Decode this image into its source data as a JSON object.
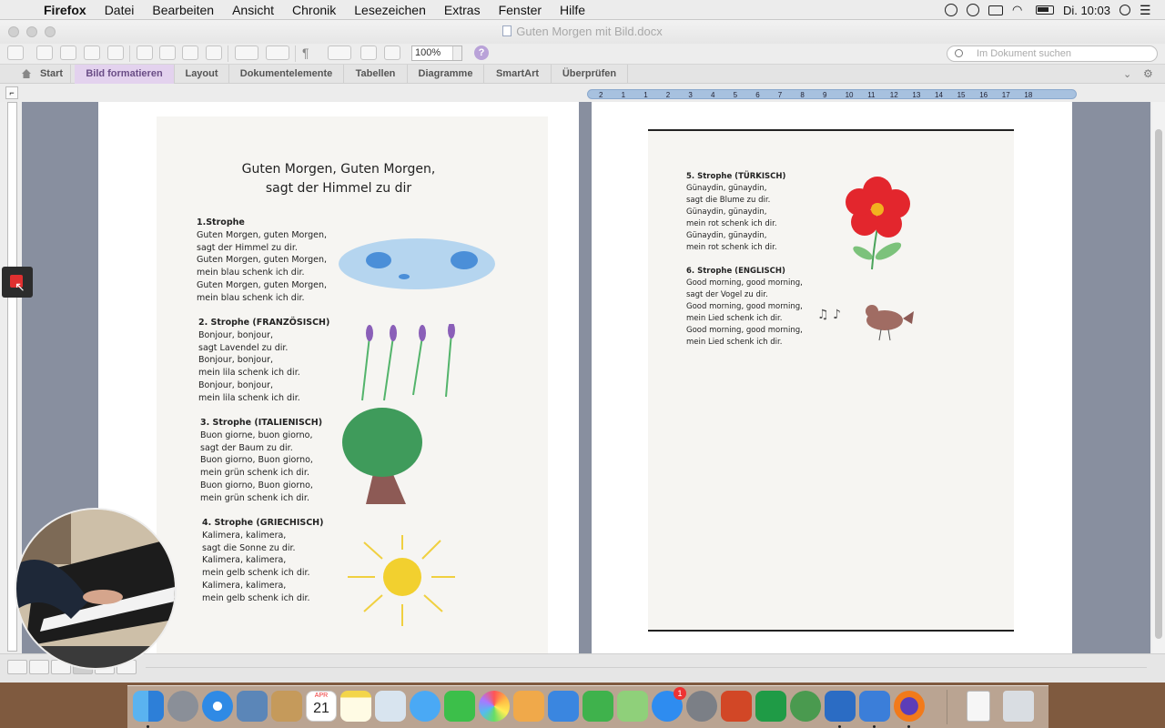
{
  "menubar": {
    "apple_glyph": "",
    "app_name": "Firefox",
    "items": [
      "Datei",
      "Bearbeiten",
      "Ansicht",
      "Chronik",
      "Lesezeichen",
      "Extras",
      "Fenster",
      "Hilfe"
    ],
    "clock": "Di. 10:03"
  },
  "window": {
    "title": "Guten Morgen mit Bild.docx",
    "zoom": "100%",
    "search_placeholder": "Im Dokument suchen"
  },
  "ribbon": {
    "tabs": [
      "Start",
      "Bild formatieren",
      "Layout",
      "Dokumentelemente",
      "Tabellen",
      "Diagramme",
      "SmartArt",
      "Überprüfen"
    ],
    "active_tab": "Bild formatieren"
  },
  "ruler": {
    "marks": [
      "2",
      "1",
      "1",
      "2",
      "3",
      "4",
      "5",
      "6",
      "7",
      "8",
      "9",
      "10",
      "11",
      "12",
      "13",
      "14",
      "15",
      "16",
      "17",
      "18"
    ]
  },
  "page1": {
    "title_line1": "Guten Morgen, Guten Morgen,",
    "title_line2": "sagt der Himmel zu dir",
    "stanzas": [
      {
        "heading": "1.Strophe",
        "lines": [
          "Guten Morgen, guten Morgen,",
          "sagt der Himmel zu dir.",
          "Guten Morgen, guten Morgen,",
          "mein blau schenk ich dir.",
          "Guten Morgen, guten Morgen,",
          "mein blau schenk ich dir."
        ]
      },
      {
        "heading": "2. Strophe (FRANZÖSISCH)",
        "lines": [
          "Bonjour, bonjour,",
          "sagt Lavendel zu dir.",
          "Bonjour, bonjour,",
          "mein lila schenk ich dir.",
          "Bonjour, bonjour,",
          "mein lila schenk ich dir."
        ]
      },
      {
        "heading": "3. Strophe (ITALIENISCH)",
        "lines": [
          "Buon giorne, buon giorno,",
          "sagt der Baum zu dir.",
          "Buon giorno, Buon giorno,",
          "mein grün schenk ich dir.",
          "Buon giorno, Buon giorno,",
          "mein grün schenk ich dir."
        ]
      },
      {
        "heading": "4. Strophe (GRIECHISCH)",
        "lines": [
          "Kalimera, kalimera,",
          "sagt die Sonne zu dir.",
          "Kalimera, kalimera,",
          "mein gelb schenk ich dir.",
          "Kalimera, kalimera,",
          "mein gelb schenk ich dir."
        ]
      }
    ]
  },
  "page2": {
    "stanzas": [
      {
        "heading": "5. Strophe (TÜRKISCH)",
        "lines": [
          "Günaydin, günaydin,",
          "sagt die Blume zu dir.",
          "Günaydin, günaydin,",
          "mein rot schenk ich dir.",
          "Günaydin, günaydin,",
          "mein rot schenk ich dir."
        ]
      },
      {
        "heading": "6. Strophe (ENGLISCH)",
        "lines": [
          "Good morning, good morning,",
          "sagt der Vogel zu dir.",
          "Good morning, good morning,",
          "mein Lied schenk ich dir.",
          "Good morning, good morning,",
          "mein Lied schenk ich dir."
        ]
      }
    ]
  },
  "dock": {
    "apps": [
      "finder-icon",
      "launchpad-icon",
      "safari-icon",
      "mail-icon",
      "contacts-icon",
      "calendar-icon",
      "notes-icon",
      "preview-icon",
      "messages-icon",
      "facetime-icon",
      "photos-icon",
      "pages-icon",
      "keynote-icon",
      "numbers-icon",
      "maps-icon",
      "app-store-icon",
      "system-preferences-icon",
      "powerpoint-icon",
      "excel-icon",
      "download-icon",
      "word-icon",
      "teamviewer-icon",
      "firefox-icon",
      "document-icon",
      "trash-icon"
    ],
    "calendar_month": "APR",
    "calendar_day": "21",
    "app_store_badge": "1"
  },
  "colors": {
    "ribbon_active": "#e3d2ee",
    "ruler_blue": "#a7c1df",
    "record_red": "#e03030"
  }
}
